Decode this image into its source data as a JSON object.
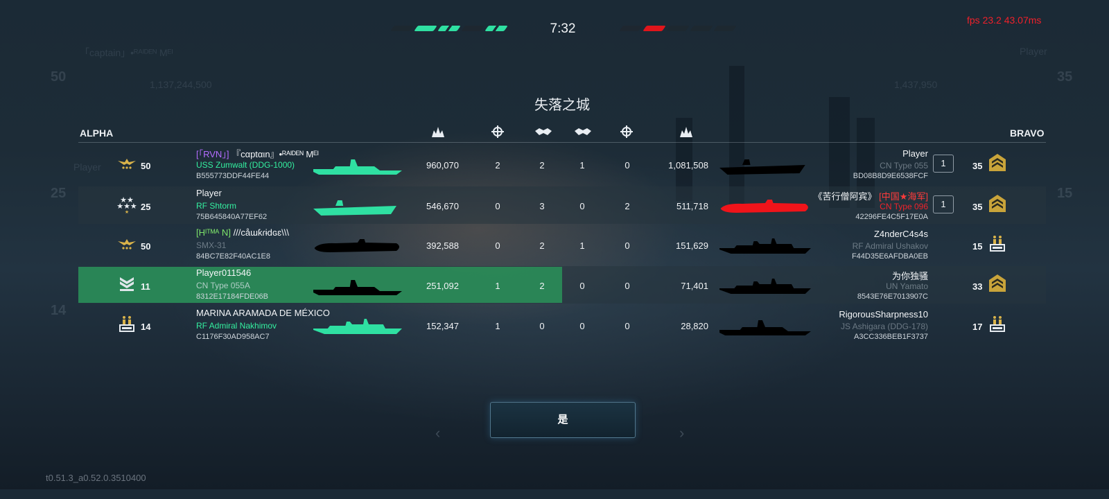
{
  "hud": {
    "timer": "7:32",
    "fps": "fps 23.2  43.07ms",
    "version": "t0.51.3_a0.52.0.3510400",
    "alpha_pips": [
      "empty",
      "green",
      "green-dim",
      "dark",
      "green-dim"
    ],
    "bravo_pips": [
      "dark",
      "red",
      "empty",
      "empty",
      "empty"
    ]
  },
  "map_name": "失落之城",
  "headers": {
    "alpha": "ALPHA",
    "bravo": "BRAVO",
    "columns": [
      "damage-left",
      "crosshair-left",
      "handshake-left",
      "handshake-right",
      "crosshair-right",
      "damage-right"
    ]
  },
  "colors": {
    "ally_ship": "#2fe0a2",
    "enemy_ship_target": "#f0141a",
    "highlight_row": "#2a8c58",
    "alert_red": "#f0202a"
  },
  "alpha": [
    {
      "rank_icon": "eagle-badge-icon",
      "level": "50",
      "tag": "[「RVN」]",
      "name": "『cαptαιn』•ᴿᴬᴵᴰᴱᴺ Mᴱᴵ",
      "ship": "USS Zumwalt (DDG-1000)",
      "id": "B555773DDF44FE44",
      "damage": "960,070",
      "kills": "2",
      "assists": "2"
    },
    {
      "rank_icon": "stars-badge-icon",
      "level": "25",
      "tag": "",
      "name": "Player",
      "ship": "RF Shtorm",
      "id": "75B645840A77EF62",
      "damage": "546,670",
      "kills": "0",
      "assists": "3"
    },
    {
      "rank_icon": "eagle-badge-icon",
      "level": "50",
      "tag": "[Hᴵᵀᴹᴬ N]",
      "name": "///cåɯƙɾɨdɢɛ\\\\\\",
      "ship": "SMX-31",
      "id": "84BC7E82F40AC1E8",
      "damage": "392,588",
      "kills": "0",
      "assists": "2"
    },
    {
      "rank_icon": "chevrons-badge-icon",
      "level": "11",
      "tag": "",
      "name": "Player011546",
      "ship": "CN Type 055A",
      "id": "8312E17184FDE06B",
      "damage": "251,092",
      "kills": "1",
      "assists": "2"
    },
    {
      "rank_icon": "bars-badge-icon",
      "level": "14",
      "tag": "",
      "name": "MARINA ARAMADA DE MÉXICO",
      "ship": "RF Admiral Nakhimov",
      "id": "C1176F30AD958AC7",
      "damage": "152,347",
      "kills": "1",
      "assists": "0"
    }
  ],
  "bravo": [
    {
      "rank_icon": "chevrons-gold-icon",
      "level": "35",
      "tag": "",
      "name": "Player",
      "ship": "CN Type 055",
      "id": "BD08B8D9E6538FCF",
      "damage": "1,081,508",
      "kills": "0",
      "assists": "1",
      "count": "1"
    },
    {
      "rank_icon": "chevrons-gold-icon",
      "level": "35",
      "tag": "[中国★海军]",
      "name": "《苦行僧阿宾》",
      "ship": "CN Type 096",
      "id": "42296FE4C5F17E0A",
      "damage": "511,718",
      "kills": "2",
      "assists": "0",
      "count": "1"
    },
    {
      "rank_icon": "bars-badge-icon",
      "level": "15",
      "tag": "",
      "name": "Z4nderC4s4s",
      "ship": "RF Admiral Ushakov",
      "id": "F44D35E6AFDBA0EB",
      "damage": "151,629",
      "kills": "0",
      "assists": "1"
    },
    {
      "rank_icon": "chevrons-gold-icon",
      "level": "33",
      "tag": "",
      "name": "为你独骚",
      "ship": "UN Yamato",
      "id": "8543E76E7013907C",
      "damage": "71,401",
      "kills": "0",
      "assists": "0"
    },
    {
      "rank_icon": "bars-badge-icon",
      "level": "17",
      "tag": "",
      "name": "RigorousSharpness10",
      "ship": "JS Ashigara (DDG-178)",
      "id": "A3CC336BEB1F3737",
      "damage": "28,820",
      "kills": "0",
      "assists": "0"
    }
  ],
  "background": {
    "left_name": "「captain」•ᴿᴬᴵᴰᴱᴺ Mᴱᴵ",
    "left_level": "50",
    "left_score": "1,137,244,500",
    "left_player": "Player",
    "left_level2": "25",
    "left_level3": "14",
    "right_player": "Player",
    "right_level": "35",
    "right_score": "1,437,950",
    "right_level2": "15"
  },
  "ok_button": "是"
}
